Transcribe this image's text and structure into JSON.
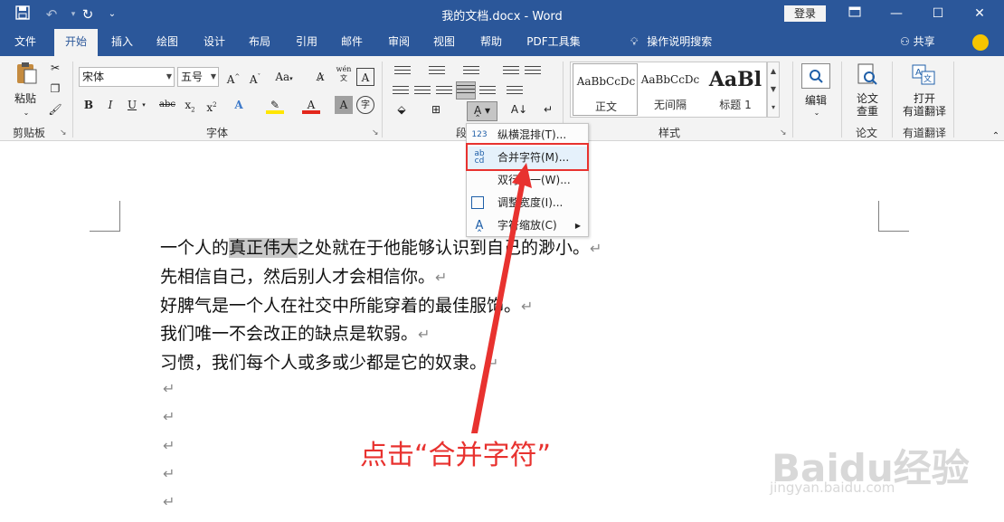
{
  "window": {
    "title": "我的文档.docx  -  Word",
    "login_label": "登录",
    "quick_access": {
      "save": "save-icon",
      "undo": "undo-icon",
      "redo": "redo-icon",
      "customize": "customize-icon"
    }
  },
  "tabs": [
    "文件",
    "开始",
    "插入",
    "绘图",
    "设计",
    "布局",
    "引用",
    "邮件",
    "审阅",
    "视图",
    "帮助",
    "PDF工具集"
  ],
  "active_tab": "开始",
  "tell_me": "操作说明搜索",
  "share": "共享",
  "ribbon": {
    "clipboard": {
      "paste": "粘贴",
      "label": "剪贴板"
    },
    "font": {
      "name": "宋体",
      "size": "五号",
      "label": "字体",
      "aa": "Aa",
      "wen": "wén"
    },
    "paragraph": {
      "label": "段落"
    },
    "styles": {
      "label": "样式",
      "items": [
        {
          "preview": "AaBbCcDc",
          "name": "正文"
        },
        {
          "preview": "AaBbCcDc",
          "name": "无间隔"
        },
        {
          "preview": "AaBl",
          "name": "标题 1"
        }
      ]
    },
    "editing": {
      "label": "编辑"
    },
    "recheck": {
      "button": "论文\n查重",
      "label": "论文"
    },
    "youdao": {
      "button": "打开\n有道翻译",
      "label": "有道翻译"
    }
  },
  "dropdown_menu": {
    "items": [
      {
        "label": "纵横混排(T)...",
        "icon": "vertical-in-horizontal-icon"
      },
      {
        "label": "合并字符(M)...",
        "icon": "combine-characters-icon"
      },
      {
        "label": "双行合一(W)...",
        "icon": ""
      },
      {
        "label": "调整宽度(I)...",
        "icon": "adjust-width-icon"
      },
      {
        "label": "字符缩放(C)",
        "icon": "character-scale-icon"
      }
    ],
    "highlighted": "合并字符(M)..."
  },
  "document": {
    "lines": [
      {
        "before": "一个人的",
        "highlight": "真正伟大",
        "after": "之处就在于他能够认识到自己的渺小。"
      },
      {
        "before": "先相信自己，然后别人才会相信你。",
        "highlight": "",
        "after": ""
      },
      {
        "before": "好脾气是一个人在社交中所能穿着的最佳服饰。",
        "highlight": "",
        "after": ""
      },
      {
        "before": "我们唯一不会改正的缺点是软弱。",
        "highlight": "",
        "after": ""
      },
      {
        "before": "习惯，我们每个人或多或少都是它的奴隶。",
        "highlight": "",
        "after": ""
      }
    ],
    "paragraph_mark": "↵",
    "empty_paragraphs": 5
  },
  "annotation": "点击“合并字符”",
  "watermark": {
    "text": "Baidu经验",
    "url": "jingyan.baidu.com"
  },
  "colors": {
    "title_bar": "#2b579a",
    "accent_red": "#e8322f"
  }
}
